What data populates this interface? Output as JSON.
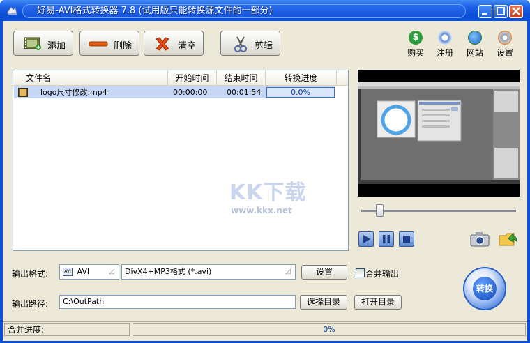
{
  "window": {
    "title": "好易-AVI格式转换器 7.8 (试用版只能转换源文件的一部分)"
  },
  "toolbar": {
    "add_label": "添加",
    "delete_label": "删除",
    "clear_label": "清空",
    "cut_label": "剪辑"
  },
  "right_tools": {
    "buy": "购买",
    "register": "注册",
    "website": "网站",
    "settings": "设置"
  },
  "file_list": {
    "columns": [
      "文件名",
      "开始时间",
      "结束时间",
      "转换进度"
    ],
    "rows": [
      {
        "name": "logo尺寸修改.mp4",
        "start": "00:00:00",
        "end": "00:01:54",
        "progress": "0.0%"
      }
    ]
  },
  "watermark": {
    "logo": "KK下载",
    "url": "www.kkx.net"
  },
  "player": {
    "seek_fraction": 0.12
  },
  "output": {
    "format_label": "输出格式:",
    "format_value": "AVI",
    "format_icon_text": "AVI",
    "codec_value": "DivX4+MP3格式 (*.avi)",
    "settings_button": "设置",
    "merge_label": "合并输出",
    "path_label": "输出路径:",
    "path_value": "C:\\OutPath",
    "choose_dir": "选择目录",
    "open_dir": "打开目录"
  },
  "convert": {
    "label": "转换"
  },
  "status": {
    "merge_progress_label": "合并进度:",
    "progress_text": "0%"
  },
  "colors": {
    "titlebar": "#0a50d8",
    "client_bg": "#ece9d8",
    "selection": "#c6d6f5",
    "list_border": "#7f9db9"
  }
}
